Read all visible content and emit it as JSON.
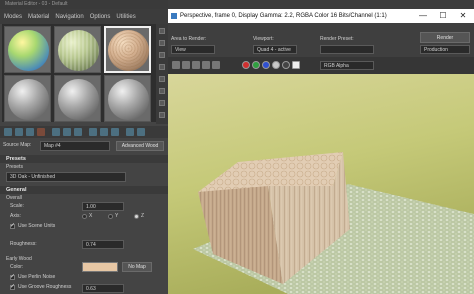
{
  "material_editor": {
    "title": "Material Editor - 03 - Default",
    "menu": [
      "Modes",
      "Material",
      "Navigation",
      "Options",
      "Utilities"
    ],
    "source_map_label": "Source Map:",
    "source_map_value": "Map #4",
    "advanced_wood_button": "Advanced Wood",
    "rollouts": {
      "presets": "Presets",
      "general": "General",
      "presets_label": "Presets",
      "preset_value": "3D Oak - Unfinished",
      "overall": "Overall",
      "scale_label": "Scale:",
      "scale_value": "1.00",
      "axis_label": "Axis:",
      "axis_options": [
        "X",
        "Y",
        "Z"
      ],
      "axis_selected": "Z",
      "use_scene_units": "Use Scene Units",
      "roughness_label": "Roughness:",
      "roughness_value": "0.74",
      "early_wood": "Early Wood",
      "color_label": "Color:",
      "color_value": "#e7c7a4",
      "no_map_button": "No Map",
      "use_perlin_noise": "Use Perlin Noise",
      "use_groove_roughness": "Use Groove Roughness",
      "groove_value": "0.63"
    }
  },
  "render_frame": {
    "title": "Perspective, frame 0, Display Gamma: 2.2, RGBA Color 16 Bits/Channel (1:1)",
    "area_to_render_label": "Area to Render:",
    "area_to_render_value": "View",
    "viewport_label": "Viewport:",
    "viewport_value": "Quad 4 - active",
    "render_preset_label": "Render Preset:",
    "render_preset_value": "",
    "render_button": "Render",
    "production_value": "Production",
    "channel_value": "RGB Alpha",
    "minimize": "—",
    "maximize": "☐",
    "close": "✕"
  }
}
